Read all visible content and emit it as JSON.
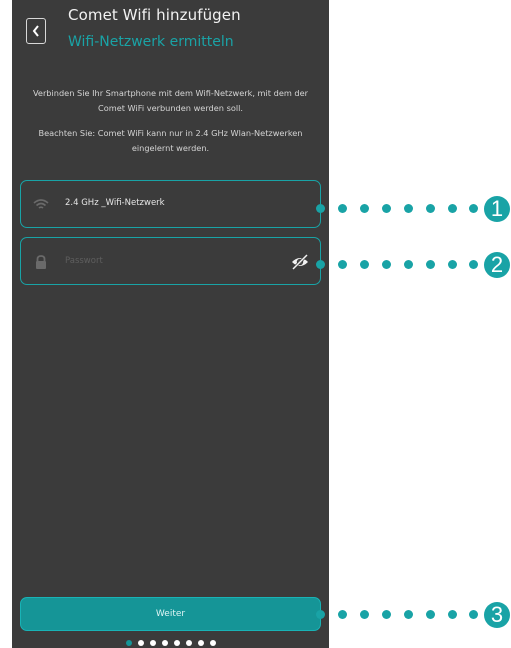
{
  "header": {
    "title": "Comet Wifi hinzufügen",
    "subtitle": "Wifi-Netzwerk ermitteln"
  },
  "description": {
    "line1": "Verbinden Sie Ihr Smartphone mit dem Wifi-Netzwerk, mit dem der",
    "line2": "Comet WiFi verbunden werden soll.",
    "line3": "Beachten Sie: Comet WiFi kann nur in 2.4 GHz Wlan-Netzwerken",
    "line4": "eingelernt werden."
  },
  "wifi_field": {
    "value": "2.4 GHz _Wifi-Netzwerk",
    "icon": "wifi-icon"
  },
  "password_field": {
    "placeholder": "Passwort",
    "icon": "lock-icon",
    "toggle_icon": "eye-off-icon"
  },
  "buttons": {
    "next_label": "Weiter"
  },
  "pager": {
    "total": 8,
    "active_index": 0
  },
  "callouts": [
    {
      "number": "1"
    },
    {
      "number": "2"
    },
    {
      "number": "3"
    }
  ],
  "colors": {
    "accent": "#19a3a6",
    "background": "#3b3b3b"
  }
}
